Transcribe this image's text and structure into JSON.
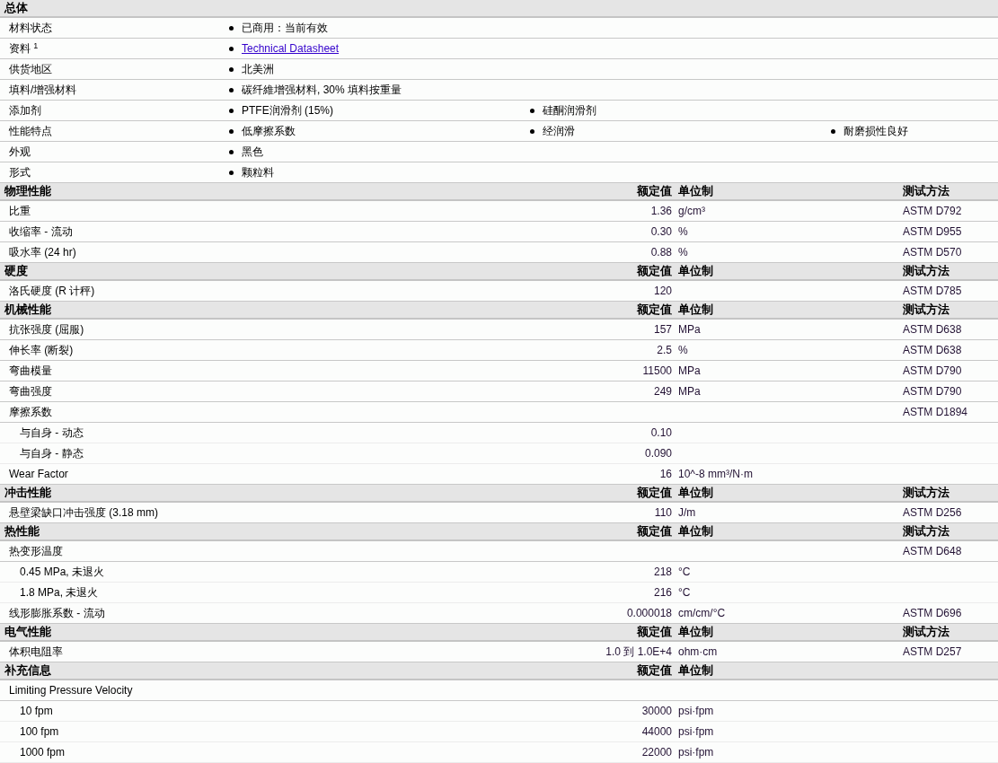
{
  "sections": [
    {
      "title": "总体",
      "kind": "general",
      "rows": [
        {
          "label": "材料状态",
          "items": [
            {
              "kind": "text",
              "text": "已商用：当前有效"
            }
          ]
        },
        {
          "label": "资料 $^{1}$",
          "items": [
            {
              "kind": "link",
              "text": "Technical Datasheet"
            }
          ]
        },
        {
          "label": "供货地区",
          "items": [
            {
              "kind": "text",
              "text": "北美洲"
            }
          ]
        },
        {
          "label": "填料/增强材料",
          "items": [
            {
              "kind": "text",
              "text": "碳纤維增强材料, 30% 填料按重量"
            }
          ]
        },
        {
          "label": "添加剂",
          "items": [
            {
              "kind": "text",
              "text": "PTFE润滑剂  (15%)"
            },
            {
              "kind": "text",
              "text": "硅酮润滑剂"
            }
          ]
        },
        {
          "label": "性能特点",
          "items": [
            {
              "kind": "text",
              "text": "低摩擦系数"
            },
            {
              "kind": "text",
              "text": "经润滑"
            },
            {
              "kind": "text",
              "text": "耐磨损性良好"
            }
          ]
        },
        {
          "label": "外观",
          "items": [
            {
              "kind": "text",
              "text": "黑色"
            }
          ]
        },
        {
          "label": "形式",
          "items": [
            {
              "kind": "text",
              "text": "颗粒料"
            }
          ]
        }
      ]
    },
    {
      "title": "物理性能",
      "kind": "property",
      "headers": {
        "value": "额定值",
        "unit": "单位制",
        "method": "测试方法"
      },
      "rows": [
        {
          "label": "比重",
          "value": "1.36",
          "unit": "g/cm³",
          "method": "ASTM D792"
        },
        {
          "label": "收缩率  - 流动",
          "value": "0.30",
          "unit": "%",
          "method": "ASTM D955"
        },
        {
          "label": "吸水率  (24 hr)",
          "value": "0.88",
          "unit": "%",
          "method": "ASTM D570"
        }
      ]
    },
    {
      "title": "硬度",
      "kind": "property",
      "headers": {
        "value": "额定值",
        "unit": "单位制",
        "method": "测试方法"
      },
      "rows": [
        {
          "label": "洛氏硬度  (R 计秤)",
          "value": "120",
          "method": "ASTM D785"
        }
      ]
    },
    {
      "title": "机械性能",
      "kind": "property",
      "headers": {
        "value": "额定值",
        "unit": "单位制",
        "method": "测试方法"
      },
      "rows": [
        {
          "label": "抗张强度  (屈服)",
          "value": "157",
          "unit": "MPa",
          "method": "ASTM D638"
        },
        {
          "label": "伸长率  (断裂)",
          "value": "2.5",
          "unit": "%",
          "method": "ASTM D638"
        },
        {
          "label": "弯曲模量",
          "value": "11500",
          "unit": "MPa",
          "method": "ASTM D790"
        },
        {
          "label": "弯曲强度",
          "value": "249",
          "unit": "MPa",
          "method": "ASTM D790"
        },
        {
          "label": "摩擦系数",
          "method": "ASTM D1894",
          "children": [
            {
              "label": "与自身  - 动态",
              "value": "0.10"
            },
            {
              "label": "与自身  - 静态",
              "value": "0.090"
            }
          ]
        },
        {
          "label": "Wear Factor",
          "value": "16",
          "unit": "10^-8 mm³/N·m"
        }
      ]
    },
    {
      "title": "冲击性能",
      "kind": "property",
      "headers": {
        "value": "额定值",
        "unit": "单位制",
        "method": "测试方法"
      },
      "rows": [
        {
          "label": "悬壁梁缺口冲击强度  (3.18 mm)",
          "value": "110",
          "unit": "J/m",
          "method": "ASTM D256"
        }
      ]
    },
    {
      "title": "热性能",
      "kind": "property",
      "headers": {
        "value": "额定值",
        "unit": "单位制",
        "method": "测试方法"
      },
      "rows": [
        {
          "label": "热变形温度",
          "method": "ASTM D648",
          "children": [
            {
              "label": "0.45 MPa, 未退火",
              "value": "218",
              "unit": "°C"
            },
            {
              "label": "1.8 MPa, 未退火",
              "value": "216",
              "unit": "°C"
            }
          ]
        },
        {
          "label": "线形膨胀系数  - 流动",
          "value": "0.000018",
          "unit": "cm/cm/°C",
          "method": "ASTM D696"
        }
      ]
    },
    {
      "title": "电气性能",
      "kind": "property",
      "headers": {
        "value": "额定值",
        "unit": "单位制",
        "method": "测试方法"
      },
      "rows": [
        {
          "label": "体积电阻率",
          "value": "1.0 到  1.0E+4",
          "unit": "ohm·cm",
          "method": "ASTM D257"
        }
      ]
    },
    {
      "title": "补充信息",
      "kind": "property",
      "headers": {
        "value": "额定值",
        "unit": "单位制"
      },
      "rows": [
        {
          "label": "Limiting Pressure Velocity",
          "children": [
            {
              "label": "10 fpm",
              "value": "30000",
              "unit": "psi·fpm"
            },
            {
              "label": "100 fpm",
              "value": "44000",
              "unit": "psi·fpm"
            },
            {
              "label": "1000 fpm",
              "value": "22000",
              "unit": "psi·fpm"
            }
          ]
        }
      ]
    }
  ]
}
